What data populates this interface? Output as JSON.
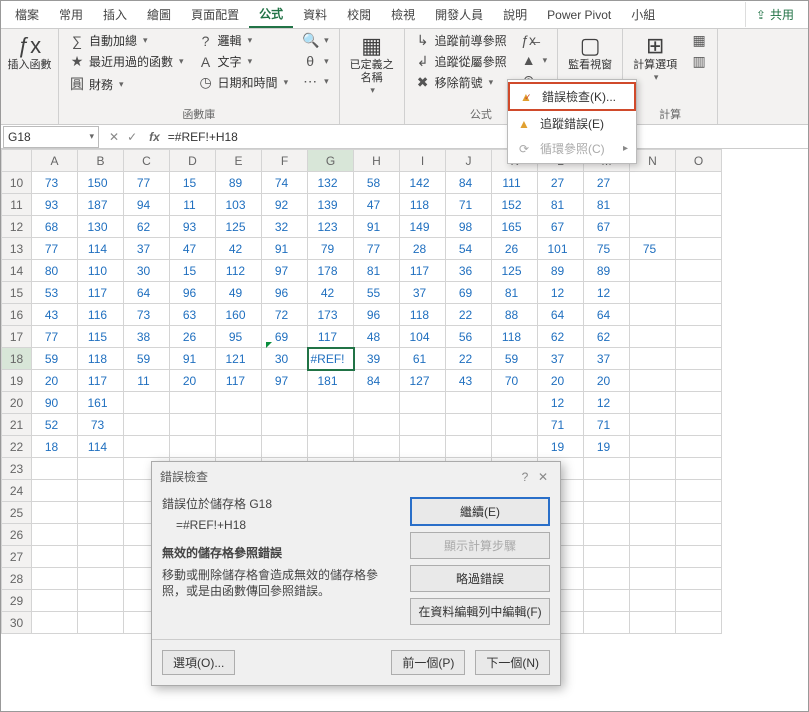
{
  "tabs": [
    "檔案",
    "常用",
    "插入",
    "繪圖",
    "頁面配置",
    "公式",
    "資料",
    "校閱",
    "檢視",
    "開發人員",
    "說明",
    "Power Pivot",
    "小組"
  ],
  "share": "共用",
  "activeTab": 5,
  "ribbon": {
    "insertFn": "插入函數",
    "lib": {
      "autosum": "自動加總",
      "recent": "最近用過的函數",
      "financial": "財務",
      "logical": "邏輯",
      "text": "文字",
      "datetime": "日期和時間",
      "more1": "",
      "more2": "",
      "more3": "",
      "label": "函數庫"
    },
    "defnames": "已定義之\n名稱",
    "audit": {
      "tracePrec": "追蹤前導參照",
      "traceDep": "追蹤從屬參照",
      "removeArrows": "移除箭號",
      "label": "公式",
      "errchk": "錯誤檢查"
    },
    "menu": {
      "errcheck": "錯誤檢查(K)...",
      "traceerr": "追蹤錯誤(E)",
      "circref": "循環參照(C)"
    },
    "watch": "監看視窗",
    "calcopt": "計算選項",
    "calclabel": "計算"
  },
  "namebox": "G18",
  "formula": "=#REF!+H18",
  "cols": [
    "A",
    "B",
    "C",
    "D",
    "E",
    "F",
    "G",
    "H",
    "I",
    "J",
    "K",
    "L",
    "M",
    "N",
    "O"
  ],
  "rowStart": 10,
  "rowCount": 21,
  "selRow": 18,
  "selCol": "G",
  "chart_data": {
    "type": "table",
    "columns": [
      "A",
      "B",
      "C",
      "D",
      "E",
      "F",
      "G",
      "H",
      "I",
      "J",
      "K",
      "L",
      "M"
    ],
    "rows": {
      "10": [
        73,
        150,
        77,
        15,
        89,
        74,
        132,
        58,
        142,
        84,
        111,
        27,
        27
      ],
      "11": [
        93,
        187,
        94,
        11,
        103,
        92,
        139,
        47,
        118,
        71,
        152,
        81,
        81
      ],
      "12": [
        68,
        130,
        62,
        93,
        125,
        32,
        123,
        91,
        149,
        98,
        165,
        67,
        67
      ],
      "13": [
        77,
        114,
        37,
        47,
        42,
        91,
        79,
        77,
        28,
        54,
        26,
        101,
        75,
        75
      ],
      "14": [
        80,
        110,
        30,
        15,
        112,
        97,
        178,
        81,
        117,
        36,
        125,
        89,
        89
      ],
      "15": [
        53,
        117,
        64,
        96,
        49,
        96,
        42,
        55,
        37,
        69,
        81,
        12,
        12
      ],
      "16": [
        43,
        116,
        73,
        63,
        160,
        72,
        173,
        96,
        118,
        22,
        88,
        64,
        64
      ],
      "17": [
        77,
        115,
        38,
        26,
        95,
        69,
        117,
        48,
        104,
        56,
        118,
        62,
        62
      ],
      "18": [
        59,
        118,
        59,
        91,
        121,
        30,
        "#REF!",
        39,
        61,
        22,
        59,
        37,
        37
      ],
      "19": [
        20,
        117,
        11,
        20,
        117,
        97,
        181,
        84,
        127,
        43,
        70,
        20,
        20
      ],
      "20": [
        90,
        161,
        null,
        null,
        null,
        null,
        null,
        null,
        null,
        null,
        null,
        12,
        12
      ],
      "21": [
        52,
        73,
        null,
        null,
        null,
        null,
        null,
        null,
        null,
        null,
        null,
        71,
        71
      ],
      "22": [
        18,
        114,
        null,
        null,
        null,
        null,
        null,
        null,
        null,
        null,
        null,
        19,
        19
      ]
    }
  },
  "dialog": {
    "title": "錯誤檢查",
    "line1": "錯誤位於儲存格 G18",
    "formula": "=#REF!+H18",
    "heading": "無效的儲存格參照錯誤",
    "msg": "移動或刪除儲存格會造成無效的儲存格參照，或是由函數傳回參照錯誤。",
    "btnContinue": "繼續(E)",
    "btnSteps": "顯示計算步驟",
    "btnSkip": "略過錯誤",
    "btnEdit": "在資料編輯列中編輯(F)",
    "btnOptions": "選項(O)...",
    "btnPrev": "前一個(P)",
    "btnNext": "下一個(N)"
  }
}
